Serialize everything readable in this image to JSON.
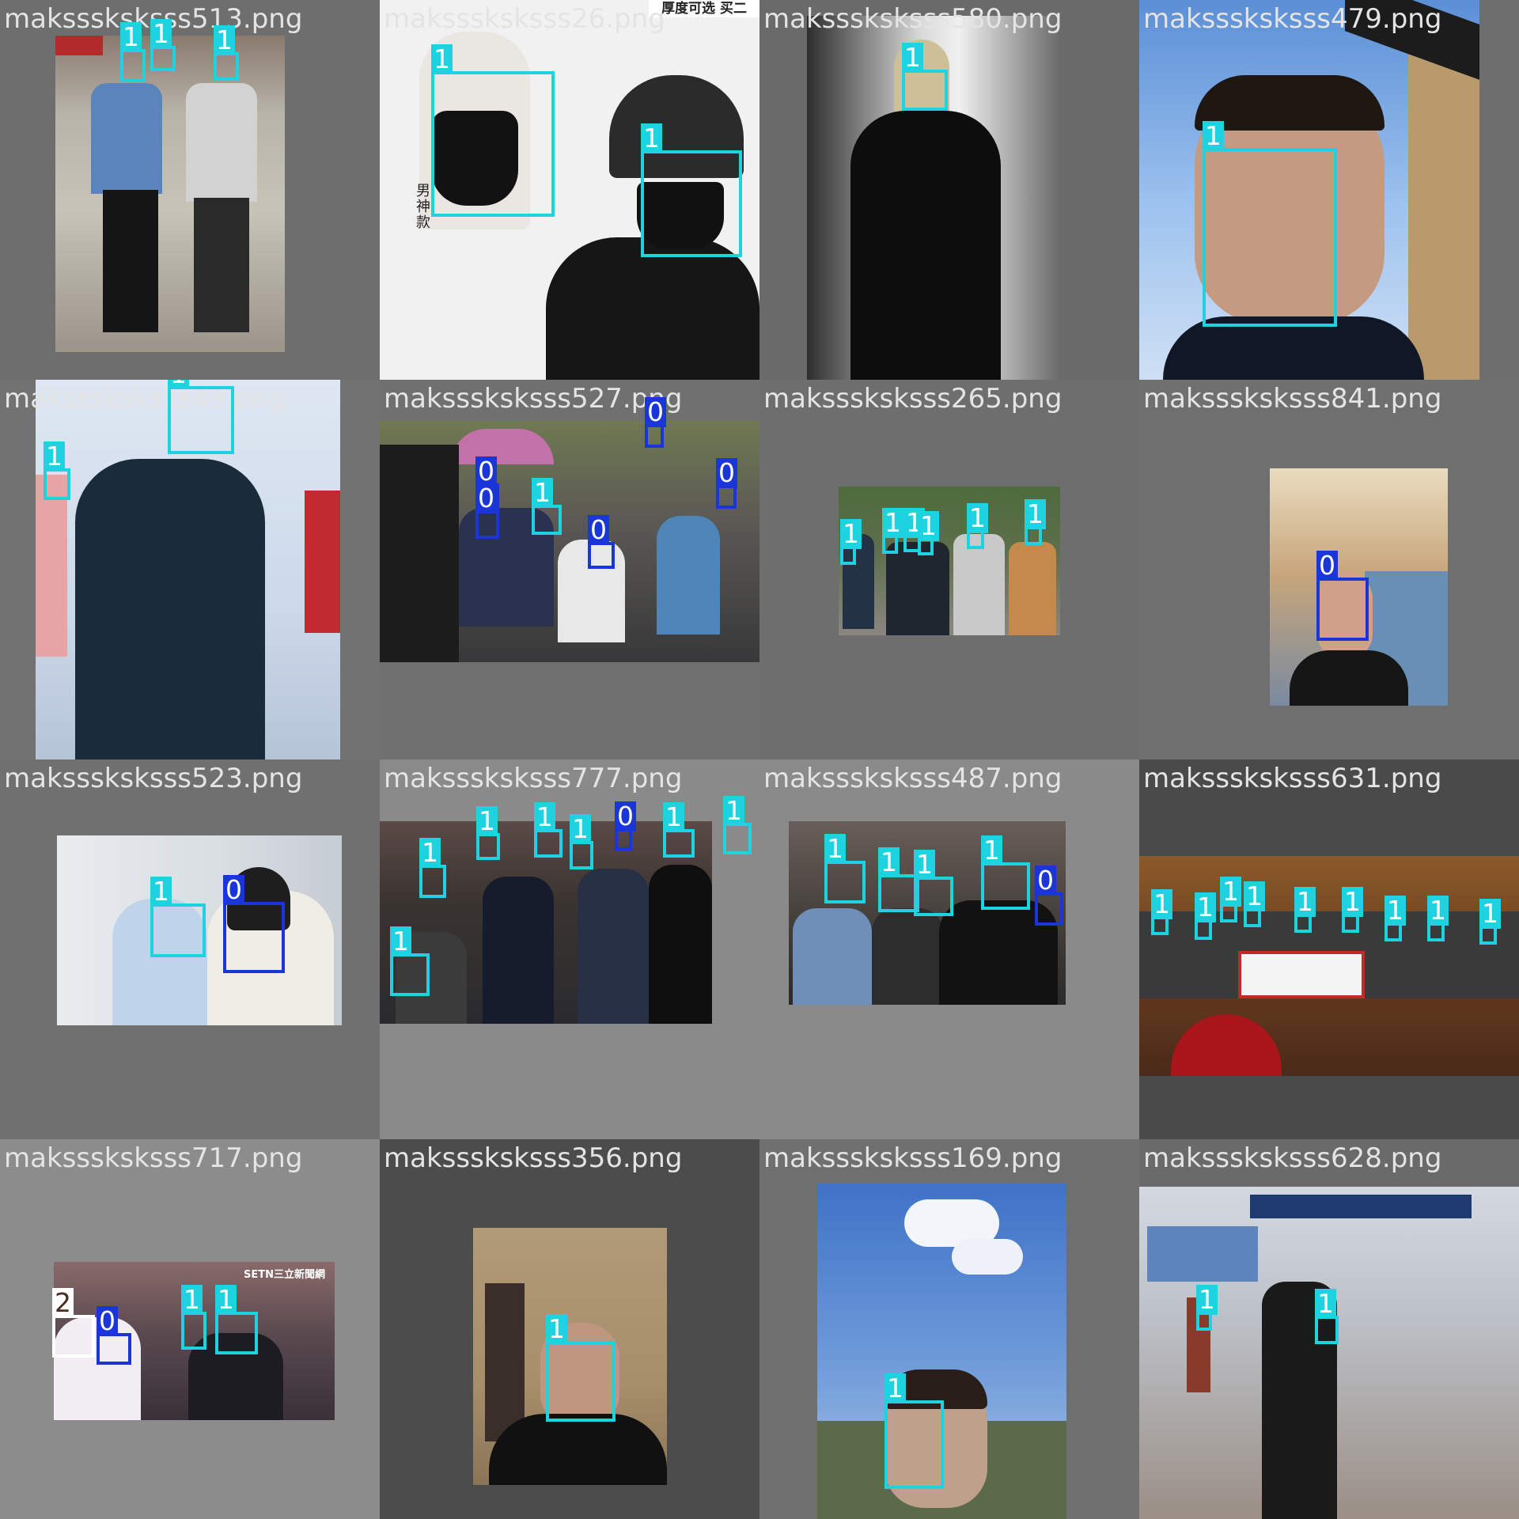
{
  "grid": {
    "cells": [
      {
        "filename": "maksssksksss513.png",
        "labels": [
          "1",
          "1",
          "1"
        ],
        "bg": "#6e6e6e"
      },
      {
        "filename": "maksssksksss26.png",
        "labels": [
          "1",
          "1"
        ],
        "bg": "#6e6e6e",
        "overlay_text": [
          "厚度可选 买二",
          "男",
          "神",
          "款"
        ]
      },
      {
        "filename": "maksssksksss580.png",
        "labels": [
          "1"
        ],
        "bg": "#6a6a6a"
      },
      {
        "filename": "maksssksksss479.png",
        "labels": [
          "1"
        ],
        "bg": "#6e6e6e"
      },
      {
        "filename": "maksssksksss49.png",
        "labels": [
          "1",
          "1"
        ],
        "bg": "#727272"
      },
      {
        "filename": "maksssksksss527.png",
        "labels": [
          "0",
          "0",
          "0",
          "1",
          "0",
          "0"
        ],
        "bg": "#707070"
      },
      {
        "filename": "maksssksksss265.png",
        "labels": [
          "1",
          "1",
          "1",
          "1",
          "1",
          "1"
        ],
        "bg": "#6e6e6e"
      },
      {
        "filename": "maksssksksss841.png",
        "labels": [
          "0"
        ],
        "bg": "#6f6f6f"
      },
      {
        "filename": "maksssksksss523.png",
        "labels": [
          "1",
          "0"
        ],
        "bg": "#707070"
      },
      {
        "filename": "maksssksksss777.png",
        "labels": [
          "1",
          "1",
          "1",
          "1",
          "0",
          "1",
          "1",
          "1"
        ],
        "bg": "#8a8a8a"
      },
      {
        "filename": "maksssksksss487.png",
        "labels": [
          "1",
          "1",
          "1",
          "1",
          "0"
        ],
        "bg": "#8a8a8a"
      },
      {
        "filename": "maksssksksss631.png",
        "labels": [
          "1",
          "1",
          "1",
          "1",
          "1",
          "1",
          "1",
          "1",
          "1"
        ],
        "bg": "#4a4a4a"
      },
      {
        "filename": "maksssksksss717.png",
        "labels": [
          "2",
          "0",
          "1",
          "1"
        ],
        "bg": "#8c8c8c",
        "overlay_text": [
          "SETN三立新聞網"
        ]
      },
      {
        "filename": "maksssksksss356.png",
        "labels": [
          "1"
        ],
        "bg": "#4c4c4c"
      },
      {
        "filename": "maksssksksss169.png",
        "labels": [
          "1"
        ],
        "bg": "#6f6f6f"
      },
      {
        "filename": "maksssksksss628.png",
        "labels": [
          "1",
          "1"
        ],
        "bg": "#6a6a6a"
      }
    ]
  },
  "colors": {
    "class_0": "#1a36d8",
    "class_1": "#1fd2e0",
    "class_2": "#ffffff",
    "filename_text": "#e4e4e4"
  }
}
